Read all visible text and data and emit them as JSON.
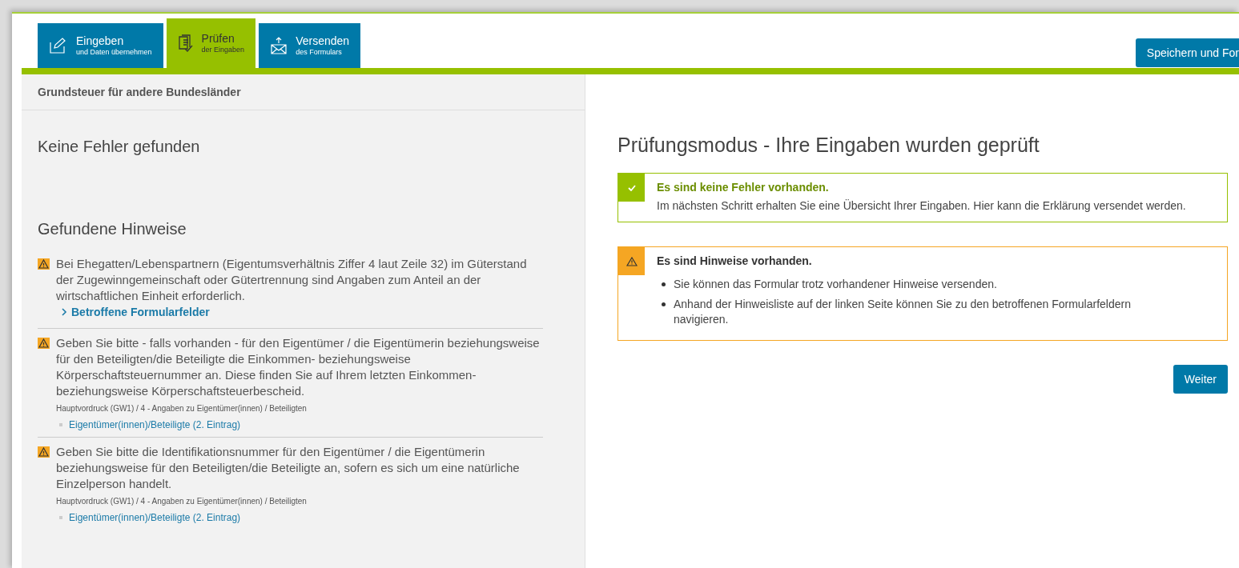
{
  "steps": [
    {
      "title": "Eingeben",
      "subtitle": "und Daten übernehmen",
      "kind": "edit",
      "selected": false
    },
    {
      "title": "Prüfen",
      "subtitle": "der Eingaben",
      "kind": "check",
      "selected": true
    },
    {
      "title": "Versenden",
      "subtitle": "des Formulars",
      "kind": "send",
      "selected": false
    }
  ],
  "save_button": "Speichern und For",
  "left": {
    "form_title": "Grundsteuer für andere Bundesländer",
    "errors_heading": "Keine Fehler gefunden",
    "hints_heading": "Gefundene Hinweise",
    "hints": [
      {
        "text": "Bei Ehegatten/Lebenspartnern (Eigentumsverhältnis Ziffer 4 laut Zeile 32) im Güterstand der Zugewinngemeinschaft oder Gütertrennung sind Angaben zum Anteil an der wirtschaftlichen Einheit erforderlich.",
        "kind": "expander",
        "link": "Betroffene Formularfelder"
      },
      {
        "text": "Geben Sie bitte - falls vorhanden - für den Eigentümer / die Eigentümerin beziehungsweise für den Beteiligten/die Beteiligte die Einkommen- beziehungsweise Körperschaftsteuernummer an. Diese finden Sie auf Ihrem letzten Einkommen- beziehungsweise Körperschaftsteuerbescheid.",
        "kind": "field",
        "path": "Hauptvordruck (GW1) / 4 - Angaben zu Eigentümer(innen) / Beteiligten",
        "link": "Eigentümer(innen)/Beteiligte (2. Eintrag)"
      },
      {
        "text": "Geben Sie bitte die Identifikationsnummer für den Eigentümer / die Eigentümerin beziehungsweise für den Beteiligten/die Beteiligte an, sofern es sich um eine natürliche Einzelperson handelt.",
        "kind": "field",
        "path": "Hauptvordruck (GW1) / 4 - Angaben zu Eigentümer(innen) / Beteiligten",
        "link": "Eigentümer(innen)/Beteiligte (2. Eintrag)"
      }
    ]
  },
  "right": {
    "heading": "Prüfungsmodus - Ihre Eingaben wurden geprüft",
    "messages": [
      {
        "kind": "success",
        "title": "Es sind keine Fehler vorhanden.",
        "text": "Im nächsten Schritt erhalten Sie eine Übersicht Ihrer Eingaben. Hier kann die Erklärung versendet werden."
      },
      {
        "kind": "warning",
        "title": "Es sind Hinweise vorhanden.",
        "items": [
          "Sie können das Formular trotz vorhandener Hinweise versenden.",
          "Anhand der Hinweisliste auf der linken Seite können Sie zu den betroffenen Formularfeldern navigieren."
        ]
      }
    ],
    "next_button": "Weiter"
  }
}
